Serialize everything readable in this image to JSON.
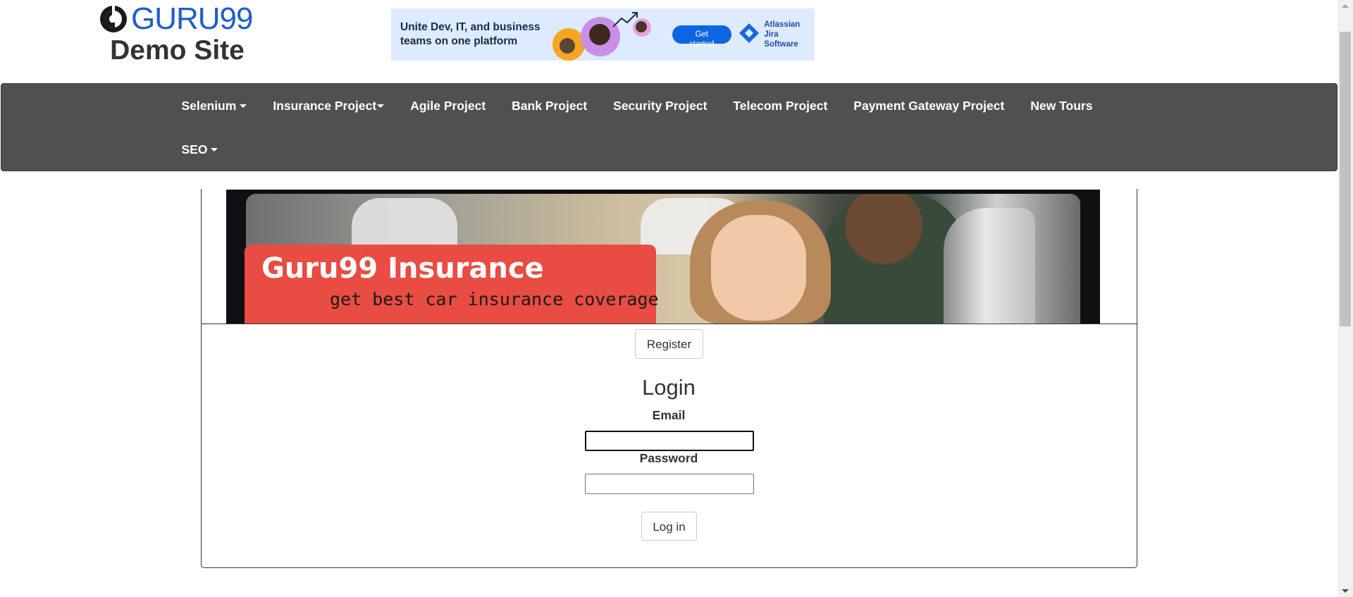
{
  "header": {
    "logo_text": "GURU99",
    "site_subtitle": "Demo Site"
  },
  "ad": {
    "headline": "Unite Dev, IT, and business teams on one platform",
    "cta_label": "Get started",
    "brand_line1": "Atlassian",
    "brand_line2": "Jira Software"
  },
  "nav": {
    "row1": [
      {
        "label": "Selenium",
        "dropdown": true
      },
      {
        "label": "Insurance Project",
        "dropdown": true
      },
      {
        "label": "Agile Project",
        "dropdown": false
      },
      {
        "label": "Bank Project",
        "dropdown": false
      },
      {
        "label": "Security Project",
        "dropdown": false
      },
      {
        "label": "Telecom Project",
        "dropdown": false
      },
      {
        "label": "Payment Gateway Project",
        "dropdown": false
      },
      {
        "label": "New Tours",
        "dropdown": false
      }
    ],
    "row2": [
      {
        "label": "SEO",
        "dropdown": true
      }
    ]
  },
  "hero": {
    "title": "Guru99 Insurance",
    "subtitle": "get best car insurance coverage"
  },
  "main": {
    "register_label": "Register",
    "login_title": "Login",
    "email_label": "Email",
    "email_value": "",
    "password_label": "Password",
    "password_value": "",
    "login_button_label": "Log in"
  },
  "colors": {
    "navbar_bg": "#505050",
    "logo_blue": "#1e5dcc",
    "hero_red": "#e84c42",
    "ad_bg": "#deebff",
    "ad_cta": "#0c66e4"
  }
}
